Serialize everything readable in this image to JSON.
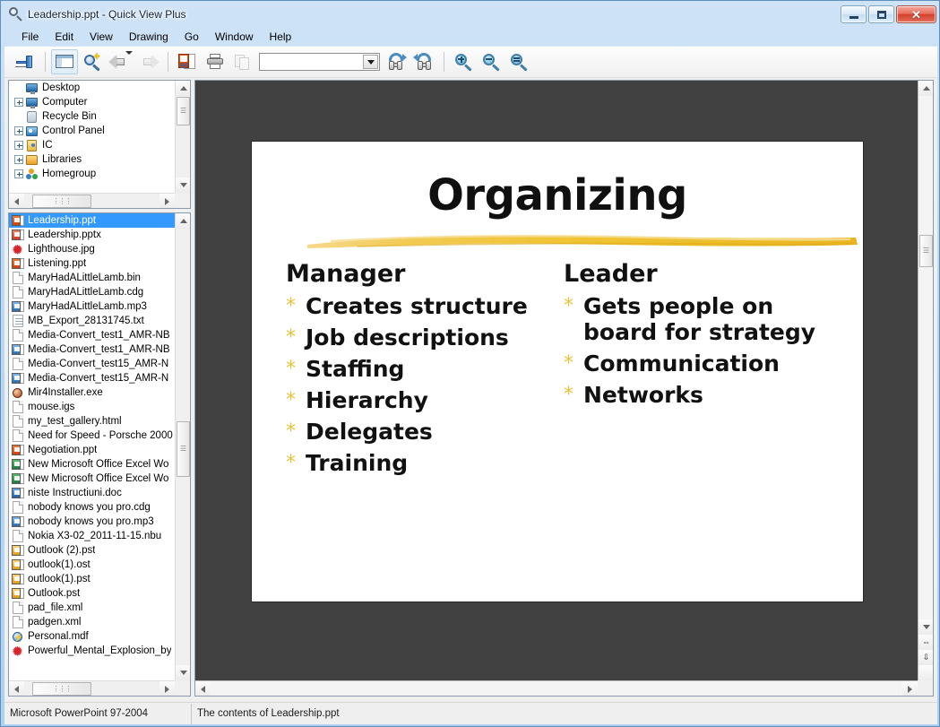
{
  "window": {
    "title": "Leadership.ppt - Quick View Plus",
    "app_icon": "magnifier-icon",
    "controls": {
      "minimize": "Minimize",
      "maximize": "Maximize",
      "close": "Close"
    }
  },
  "menubar": {
    "items": [
      {
        "label": "File"
      },
      {
        "label": "Edit"
      },
      {
        "label": "View"
      },
      {
        "label": "Drawing"
      },
      {
        "label": "Go"
      },
      {
        "label": "Window"
      },
      {
        "label": "Help"
      }
    ]
  },
  "toolbar": {
    "pin_label": "Pin",
    "pane_label": "Show/Hide Panes",
    "preview_label": "Preview",
    "back_label": "Back",
    "forward_label": "Forward",
    "open_with_label": "Open Original",
    "print_label": "Print",
    "copy_label": "Copy",
    "find_value": "",
    "find_placeholder": "",
    "find_next_label": "Find Next",
    "find_prev_label": "Find Previous",
    "zoom_in_label": "Zoom In",
    "zoom_out_label": "Zoom Out",
    "zoom_reset_label": "Zoom to Fit"
  },
  "tree": {
    "items": [
      {
        "label": "Desktop",
        "icon": "desktop-icon",
        "expander": "none",
        "indent": 0
      },
      {
        "label": "Computer",
        "icon": "computer-icon",
        "expander": "plus",
        "indent": 0
      },
      {
        "label": "Recycle Bin",
        "icon": "recycle-bin-icon",
        "expander": "none",
        "indent": 1
      },
      {
        "label": "Control Panel",
        "icon": "control-panel-icon",
        "expander": "plus",
        "indent": 0
      },
      {
        "label": "IC",
        "icon": "user-folder-icon",
        "expander": "plus",
        "indent": 0
      },
      {
        "label": "Libraries",
        "icon": "libraries-icon",
        "expander": "plus",
        "indent": 0
      },
      {
        "label": "Homegroup",
        "icon": "homegroup-icon",
        "expander": "plus",
        "indent": 0
      }
    ]
  },
  "filelist": {
    "selected_index": 0,
    "items": [
      {
        "label": "Leadership.ppt",
        "icon": "ppt-file-icon"
      },
      {
        "label": "Leadership.pptx",
        "icon": "pptx-file-icon"
      },
      {
        "label": "Lighthouse.jpg",
        "icon": "image-file-icon"
      },
      {
        "label": "Listening.ppt",
        "icon": "ppt-file-icon"
      },
      {
        "label": "MaryHadALittleLamb.bin",
        "icon": "blank-file-icon"
      },
      {
        "label": "MaryHadALittleLamb.cdg",
        "icon": "blank-file-icon"
      },
      {
        "label": "MaryHadALittleLamb.mp3",
        "icon": "audio-file-icon"
      },
      {
        "label": "MB_Export_28131745.txt",
        "icon": "text-file-icon"
      },
      {
        "label": "Media-Convert_test1_AMR-NB",
        "icon": "blank-file-icon"
      },
      {
        "label": "Media-Convert_test1_AMR-NB",
        "icon": "audio-file-icon"
      },
      {
        "label": "Media-Convert_test15_AMR-N",
        "icon": "blank-file-icon"
      },
      {
        "label": "Media-Convert_test15_AMR-N",
        "icon": "audio-file-icon"
      },
      {
        "label": "Mir4Installer.exe",
        "icon": "exe-file-icon"
      },
      {
        "label": "mouse.igs",
        "icon": "blank-file-icon"
      },
      {
        "label": "my_test_gallery.html",
        "icon": "blank-file-icon"
      },
      {
        "label": "Need for Speed - Porsche 2000",
        "icon": "blank-file-icon"
      },
      {
        "label": "Negotiation.ppt",
        "icon": "ppt-file-icon"
      },
      {
        "label": "New Microsoft Office Excel Wo",
        "icon": "xls-file-icon"
      },
      {
        "label": "New Microsoft Office Excel Wo",
        "icon": "xls-file-icon"
      },
      {
        "label": "niste Instructiuni.doc",
        "icon": "doc-file-icon"
      },
      {
        "label": "nobody knows you pro.cdg",
        "icon": "blank-file-icon"
      },
      {
        "label": "nobody knows you pro.mp3",
        "icon": "audio-file-icon"
      },
      {
        "label": "Nokia X3-02_2011-11-15.nbu",
        "icon": "blank-file-icon"
      },
      {
        "label": "Outlook (2).pst",
        "icon": "pst-file-icon"
      },
      {
        "label": "outlook(1).ost",
        "icon": "ost-file-icon"
      },
      {
        "label": "outlook(1).pst",
        "icon": "pst-file-icon"
      },
      {
        "label": "Outlook.pst",
        "icon": "pst-file-icon"
      },
      {
        "label": "pad_file.xml",
        "icon": "blank-file-icon"
      },
      {
        "label": "padgen.xml",
        "icon": "blank-file-icon"
      },
      {
        "label": "Personal.mdf",
        "icon": "mdf-file-icon"
      },
      {
        "label": "Powerful_Mental_Explosion_by",
        "icon": "image-file-icon"
      }
    ]
  },
  "slide": {
    "title": "Organizing",
    "accent_color": "#f0c33c",
    "background": "#ffffff",
    "columns": [
      {
        "heading": "Manager",
        "bullet_glyph": "*",
        "bullets": [
          "Creates structure",
          "Job descriptions",
          "Staffing",
          "Hierarchy",
          "Delegates",
          "Training"
        ]
      },
      {
        "heading": "Leader",
        "bullet_glyph": "*",
        "bullets": [
          "Gets people on board for strategy",
          "Communication",
          "Networks"
        ]
      }
    ]
  },
  "viewer_scroll": {
    "prev_page_label": "Previous Page",
    "next_page_label": "Next Page"
  },
  "statusbar": {
    "format": "Microsoft PowerPoint 97-2004",
    "description": "The contents of Leadership.ppt"
  }
}
